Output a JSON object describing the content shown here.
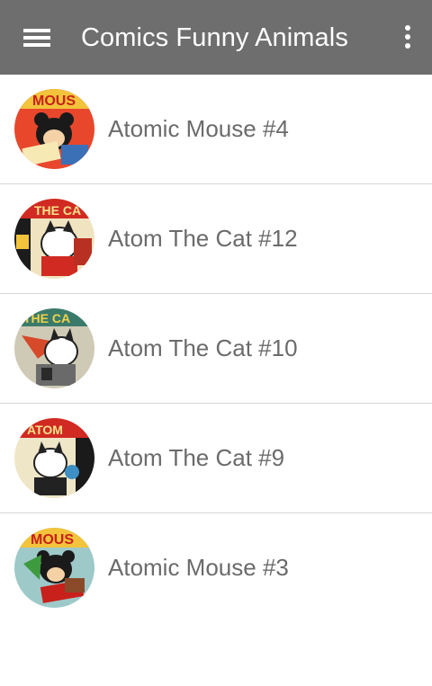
{
  "app_bar": {
    "title": "Comics Funny Animals",
    "menu_icon": "hamburger-menu-icon",
    "overflow_icon": "more-vert-icon",
    "background_color": "#6e6e6e"
  },
  "comics": [
    {
      "title": "Atomic Mouse #4",
      "cover": "atomic-mouse-cover"
    },
    {
      "title": "Atom The Cat #12",
      "cover": "atom-the-cat-cover"
    },
    {
      "title": "Atom The Cat #10",
      "cover": "atom-the-cat-cover"
    },
    {
      "title": "Atom The Cat #9",
      "cover": "atom-the-cat-cover"
    },
    {
      "title": "Atomic Mouse #3",
      "cover": "atomic-mouse-cover"
    }
  ]
}
